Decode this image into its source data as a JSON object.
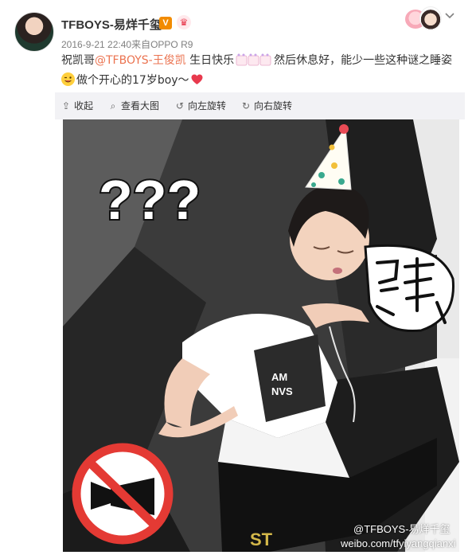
{
  "post": {
    "username": "TFBOYS-易烊千玺",
    "verified_badge": "V",
    "crown_icon": "crown-icon",
    "timestamp": "2016-9-21 22:40",
    "source_prefix": "来自",
    "source": "OPPO R9",
    "text": {
      "part1": "祝凯哥",
      "mention": "@TFBOYS-王俊凯",
      "part2": " 生日快乐",
      "part3": "然后休息好，能少一些这种谜之睡姿",
      "part4": "做个开心的17岁boy～"
    }
  },
  "toolbar": {
    "collapse_label": "收起",
    "view_large_label": "查看大图",
    "rotate_left_label": "向左旋转",
    "rotate_right_label": "向右旋转"
  },
  "image": {
    "sticker_questions": "???",
    "watermark_account": "@TFBOYS-易烊千玺",
    "watermark_url": "weibo.com/tfyiyangqianxi"
  },
  "colors": {
    "mention": "#eb7350",
    "toolbar_bg": "#f2f2f5",
    "badge": "#f28b00",
    "heart": "#e8394d"
  }
}
